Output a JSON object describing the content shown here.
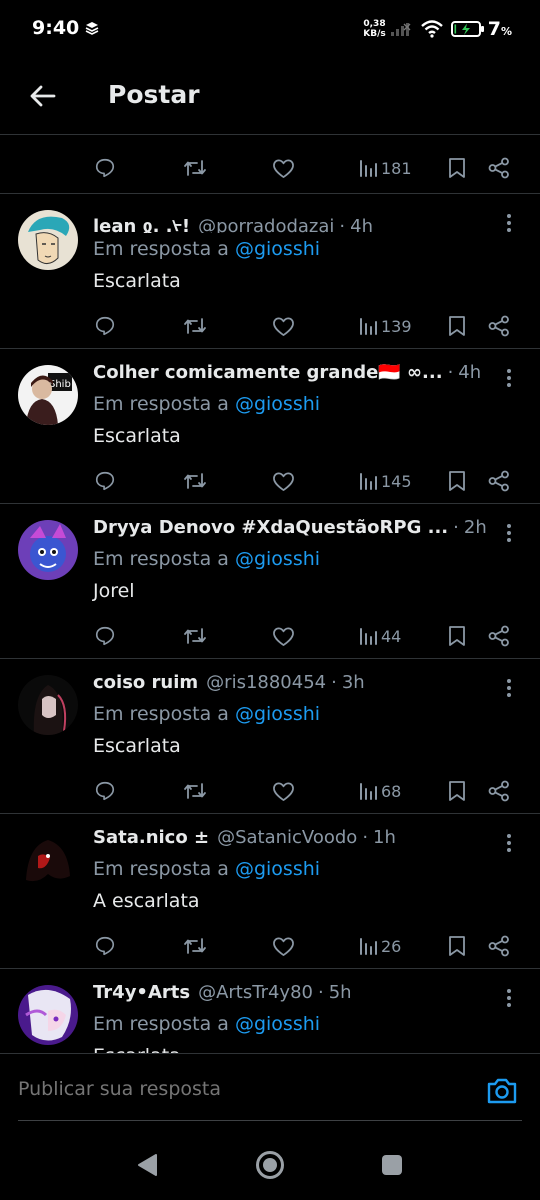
{
  "status_bar": {
    "time": "9:40",
    "net_speed_value": "0,38",
    "net_speed_unit": "KB/s",
    "battery_percent": "7",
    "battery_percent_sign": "%",
    "battery_level": 0.07
  },
  "header": {
    "title": "Postar"
  },
  "top_post": {
    "views": "181"
  },
  "replies": [
    {
      "name": "lean ჲ. .ᢣ!",
      "handle": "@porradodazai",
      "dot": "·",
      "time": "4h",
      "in_reply_prefix": "Em resposta a",
      "mention": "@giosshi",
      "text": "Escarlata",
      "views": "139"
    },
    {
      "name": "Colher comicamente grande🇮🇩 ∞...",
      "handle": "",
      "dot": "·",
      "time": "4h",
      "in_reply_prefix": "Em resposta a",
      "mention": "@giosshi",
      "text": "Escarlata",
      "views": "145"
    },
    {
      "name": "Dryya Denovo #XdaQuestãoRPG ...",
      "handle": "",
      "dot": "·",
      "time": "2h",
      "in_reply_prefix": "Em resposta a",
      "mention": "@giosshi",
      "text": "Jorel",
      "views": "44"
    },
    {
      "name": "coiso ruim",
      "handle": "@ris1880454",
      "dot": "·",
      "time": "3h",
      "in_reply_prefix": "Em resposta a",
      "mention": "@giosshi",
      "text": "Escarlata",
      "views": "68"
    },
    {
      "name": "Sata.nico ±",
      "handle": "@SatanicVoodo",
      "dot": "·",
      "time": "1h",
      "in_reply_prefix": "Em resposta a",
      "mention": "@giosshi",
      "text": "A escarlata",
      "views": "26"
    },
    {
      "name": "Tr4y•Arts",
      "handle": "@ArtsTr4y80",
      "dot": "·",
      "time": "5h",
      "in_reply_prefix": "Em resposta a",
      "mention": "@giosshi",
      "text": "Escarlata",
      "views": ""
    }
  ],
  "composer": {
    "placeholder": "Publicar sua resposta"
  },
  "icons": {
    "reply": "reply-icon",
    "repost": "repost-icon",
    "like": "heart-icon",
    "views": "views-icon",
    "bookmark": "bookmark-icon",
    "share": "share-icon",
    "camera": "camera-icon"
  },
  "colors": {
    "accent": "#1d9bf0",
    "muted_text": "#8b98a5",
    "background": "#000000",
    "divider": "#2f3336"
  }
}
